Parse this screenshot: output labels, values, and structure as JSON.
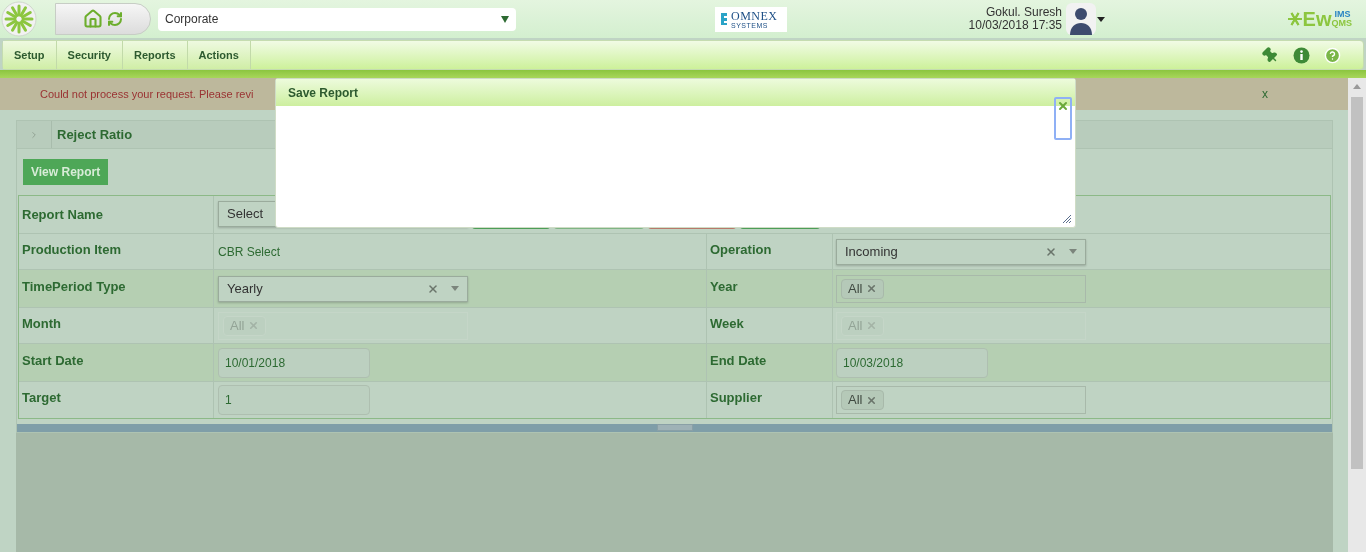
{
  "header": {
    "company_select": {
      "value": "Corporate"
    },
    "partner_logo": {
      "name": "OMNEX",
      "tagline": "SYSTEMS"
    },
    "user": {
      "name": "Gokul. Suresh",
      "datetime": "10/03/2018 17:35"
    },
    "product_logo": {
      "name": "Ew",
      "superscript": "IMS",
      "subscript": "QMS"
    }
  },
  "menu": [
    {
      "label": "Setup"
    },
    {
      "label": "Security"
    },
    {
      "label": "Reports"
    },
    {
      "label": "Actions"
    }
  ],
  "error_bar": {
    "message": "Could not process your request. Please revi",
    "close": "x"
  },
  "panel": {
    "title": "Reject Ratio",
    "expanded": false,
    "view_button": "View Report"
  },
  "report_name": {
    "label": "Report Name",
    "field": {
      "kind": "select",
      "value": "Select",
      "disabled": false
    },
    "buttons": [
      {
        "kind": "primary"
      },
      {
        "kind": "secondary"
      },
      {
        "kind": "danger"
      },
      {
        "kind": "primary"
      }
    ]
  },
  "form_rows": [
    {
      "left": {
        "label": "Production Item",
        "field": {
          "kind": "text",
          "value": "CBR Select"
        }
      },
      "right": {
        "label": "Operation",
        "field": {
          "kind": "select",
          "value": "Incoming",
          "clearable": true,
          "disabled": false
        }
      }
    },
    {
      "left": {
        "label": "TimePeriod Type",
        "field": {
          "kind": "select",
          "value": "Yearly",
          "clearable": true,
          "disabled": false
        }
      },
      "right": {
        "label": "Year",
        "field": {
          "kind": "tags",
          "tags": [
            "All"
          ],
          "disabled": false
        }
      }
    },
    {
      "left": {
        "label": "Month",
        "field": {
          "kind": "tags",
          "tags": [
            "All"
          ],
          "disabled": true
        }
      },
      "right": {
        "label": "Week",
        "field": {
          "kind": "tags",
          "tags": [
            "All"
          ],
          "disabled": true
        }
      }
    },
    {
      "left": {
        "label": "Start Date",
        "field": {
          "kind": "input",
          "value": "10/01/2018"
        }
      },
      "right": {
        "label": "End Date",
        "field": {
          "kind": "input",
          "value": "10/03/2018"
        }
      }
    },
    {
      "left": {
        "label": "Target",
        "field": {
          "kind": "input",
          "value": "1"
        }
      },
      "right": {
        "label": "Supplier",
        "field": {
          "kind": "tags",
          "tags": [
            "All"
          ],
          "disabled": false
        }
      }
    }
  ],
  "dialog": {
    "title": "Save Report"
  }
}
